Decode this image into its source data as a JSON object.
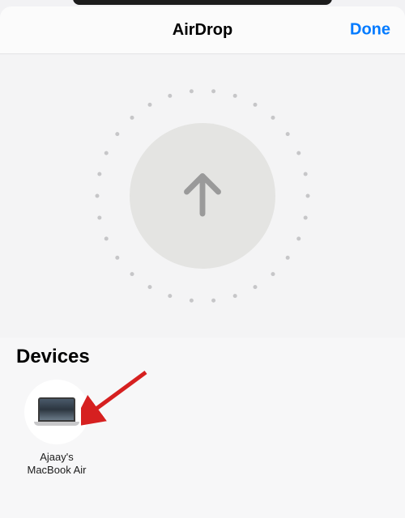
{
  "header": {
    "title": "AirDrop",
    "done_label": "Done"
  },
  "devices": {
    "heading": "Devices",
    "items": [
      {
        "label": "Ajaay's\nMacBook Air",
        "icon": "laptop-icon"
      }
    ]
  }
}
